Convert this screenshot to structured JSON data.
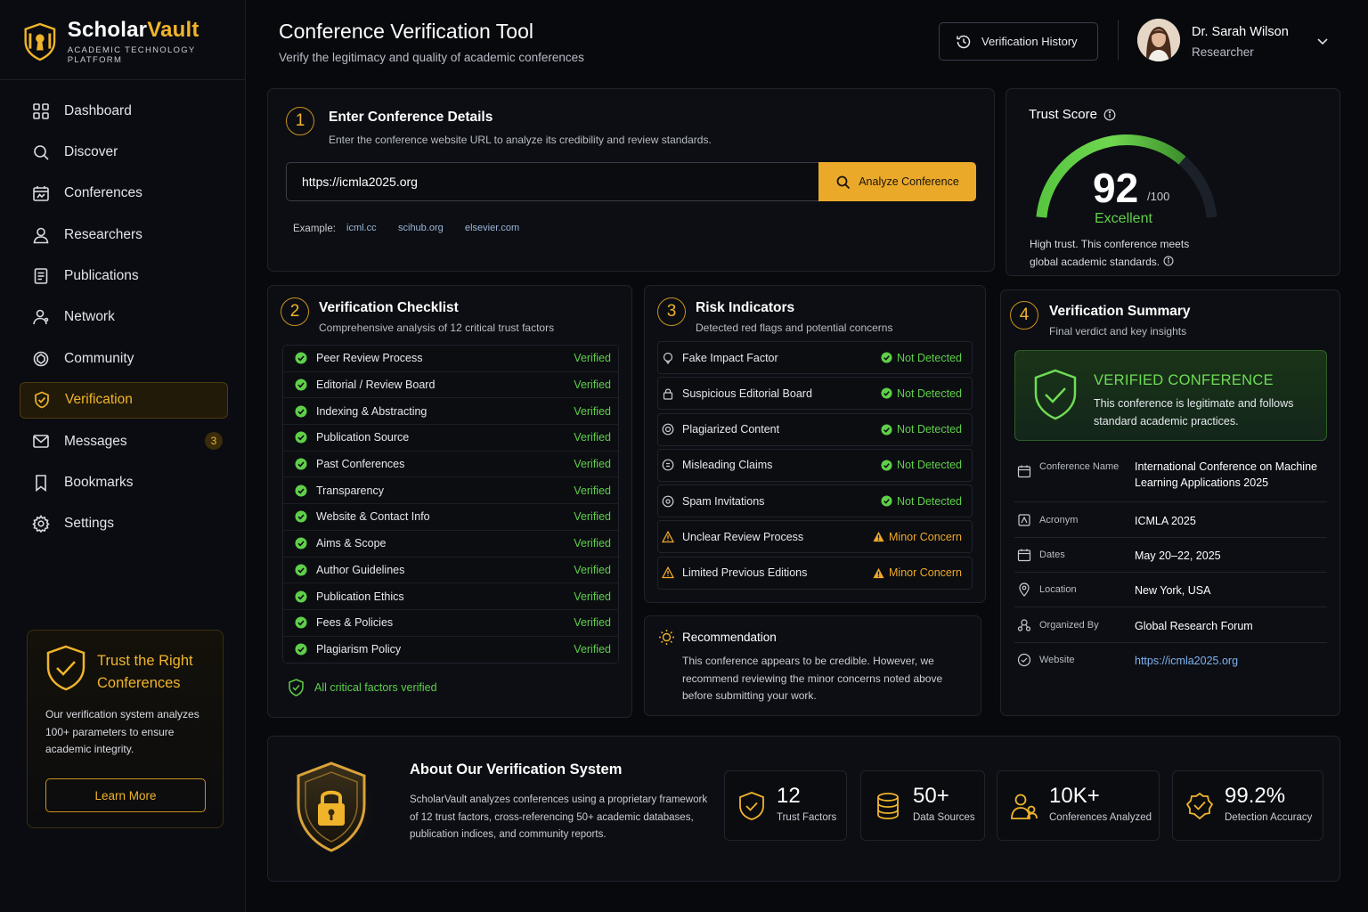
{
  "brand": {
    "name_a": "Scholar",
    "name_b": "Vault",
    "tagline": "ACADEMIC TECHNOLOGY PLATFORM"
  },
  "colors": {
    "accent": "#f0b42b",
    "success": "#5fcf4a",
    "warning": "#f0a82a",
    "link": "#7fb2ef",
    "background": "#07090d"
  },
  "sidebar": {
    "items": [
      {
        "label": "Dashboard",
        "icon": "grid-icon"
      },
      {
        "label": "Discover",
        "icon": "search-icon"
      },
      {
        "label": "Conferences",
        "icon": "calendar-icon"
      },
      {
        "label": "Researchers",
        "icon": "user-icon"
      },
      {
        "label": "Publications",
        "icon": "document-icon"
      },
      {
        "label": "Network",
        "icon": "network-icon"
      },
      {
        "label": "Community",
        "icon": "community-icon"
      },
      {
        "label": "Verification",
        "icon": "shield-check-icon",
        "active": true
      },
      {
        "label": "Messages",
        "icon": "message-icon",
        "badge": "3"
      },
      {
        "label": "Bookmarks",
        "icon": "bookmark-icon"
      },
      {
        "label": "Settings",
        "icon": "gear-icon"
      }
    ],
    "promo": {
      "title": "Trust the Right Conferences",
      "text": "Our verification system analyzes 100+ parameters to ensure academic integrity.",
      "button": "Learn More"
    }
  },
  "header": {
    "title": "Conference Verification Tool",
    "subtitle": "Verify the legitimacy and quality of academic conferences",
    "history_button": "Verification History",
    "user": {
      "name": "Dr. Sarah Wilson",
      "role": "Researcher"
    }
  },
  "enter": {
    "step": "1",
    "title": "Enter Conference Details",
    "subtitle": "Enter the conference website URL to analyze its credibility and review standards.",
    "url_value": "https://icmla2025.org",
    "analyze_button": "Analyze Conference",
    "example_label": "Example:",
    "examples": [
      "icml.cc",
      "scihub.org",
      "elsevier.com"
    ]
  },
  "trust": {
    "title": "Trust Score",
    "score": 92,
    "max_label": "/100",
    "max": 100,
    "rating": "Excellent",
    "description": "High trust. This conference meets global academic standards."
  },
  "checklist": {
    "step": "2",
    "title": "Verification Checklist",
    "subtitle": "Comprehensive analysis of 12 critical trust factors",
    "items": [
      {
        "label": "Peer Review Process",
        "status": "Verified"
      },
      {
        "label": "Editorial / Review Board",
        "status": "Verified"
      },
      {
        "label": "Indexing & Abstracting",
        "status": "Verified"
      },
      {
        "label": "Publication Source",
        "status": "Verified"
      },
      {
        "label": "Past Conferences",
        "status": "Verified"
      },
      {
        "label": "Transparency",
        "status": "Verified"
      },
      {
        "label": "Website & Contact Info",
        "status": "Verified"
      },
      {
        "label": "Aims & Scope",
        "status": "Verified"
      },
      {
        "label": "Author Guidelines",
        "status": "Verified"
      },
      {
        "label": "Publication Ethics",
        "status": "Verified"
      },
      {
        "label": "Fees & Policies",
        "status": "Verified"
      },
      {
        "label": "Plagiarism Policy",
        "status": "Verified"
      }
    ],
    "footer": "All critical factors verified"
  },
  "risk": {
    "step": "3",
    "title": "Risk Indicators",
    "subtitle": "Detected red flags and potential concerns",
    "items": [
      {
        "label": "Fake Impact Factor",
        "status": "Not Detected",
        "level": "ok",
        "icon": "target-icon"
      },
      {
        "label": "Suspicious Editorial Board",
        "status": "Not Detected",
        "level": "ok",
        "icon": "lock-icon"
      },
      {
        "label": "Plagiarized Content",
        "status": "Not Detected",
        "level": "ok",
        "icon": "copy-icon"
      },
      {
        "label": "Misleading Claims",
        "status": "Not Detected",
        "level": "ok",
        "icon": "alert-circle-icon"
      },
      {
        "label": "Spam Invitations",
        "status": "Not Detected",
        "level": "ok",
        "icon": "mail-icon"
      },
      {
        "label": "Unclear Review Process",
        "status": "Minor Concern",
        "level": "warn",
        "icon": "warning-icon"
      },
      {
        "label": "Limited Previous Editions",
        "status": "Minor Concern",
        "level": "warn",
        "icon": "warning-icon"
      }
    ]
  },
  "recommendation": {
    "title": "Recommendation",
    "text": "This conference appears to be credible. However, we recommend reviewing the minor concerns noted above before submitting your work."
  },
  "summary": {
    "step": "4",
    "title": "Verification Summary",
    "subtitle": "Final verdict and key insights",
    "verdict_title": "VERIFIED CONFERENCE",
    "verdict_text": "This conference is legitimate and follows standard academic practices.",
    "fields": [
      {
        "key": "Conference Name",
        "value": "International Conference on Machine Learning Applications 2025",
        "icon": "calendar-icon"
      },
      {
        "key": "Acronym",
        "value": "ICMLA 2025",
        "icon": "tag-icon"
      },
      {
        "key": "Dates",
        "value": "May 20–22, 2025",
        "icon": "calendar-icon"
      },
      {
        "key": "Location",
        "value": "New York, USA",
        "icon": "location-icon"
      },
      {
        "key": "Organized By",
        "value": "Global Research Forum",
        "icon": "organization-icon"
      },
      {
        "key": "Website",
        "value": "https://icmla2025.org",
        "icon": "globe-icon"
      }
    ]
  },
  "about": {
    "title": "About Our Verification System",
    "text": "ScholarVault analyzes conferences using a proprietary framework of 12 trust factors, cross-referencing 50+ academic databases, publication indices, and community reports.",
    "stats": [
      {
        "value": "12",
        "label": "Trust Factors",
        "icon": "shield-check-icon"
      },
      {
        "value": "50+",
        "label": "Data Sources",
        "icon": "database-icon"
      },
      {
        "value": "10K+",
        "label": "Conferences Analyzed",
        "icon": "users-icon"
      },
      {
        "value": "99.2%",
        "label": "Detection Accuracy",
        "icon": "badge-check-icon"
      }
    ]
  }
}
